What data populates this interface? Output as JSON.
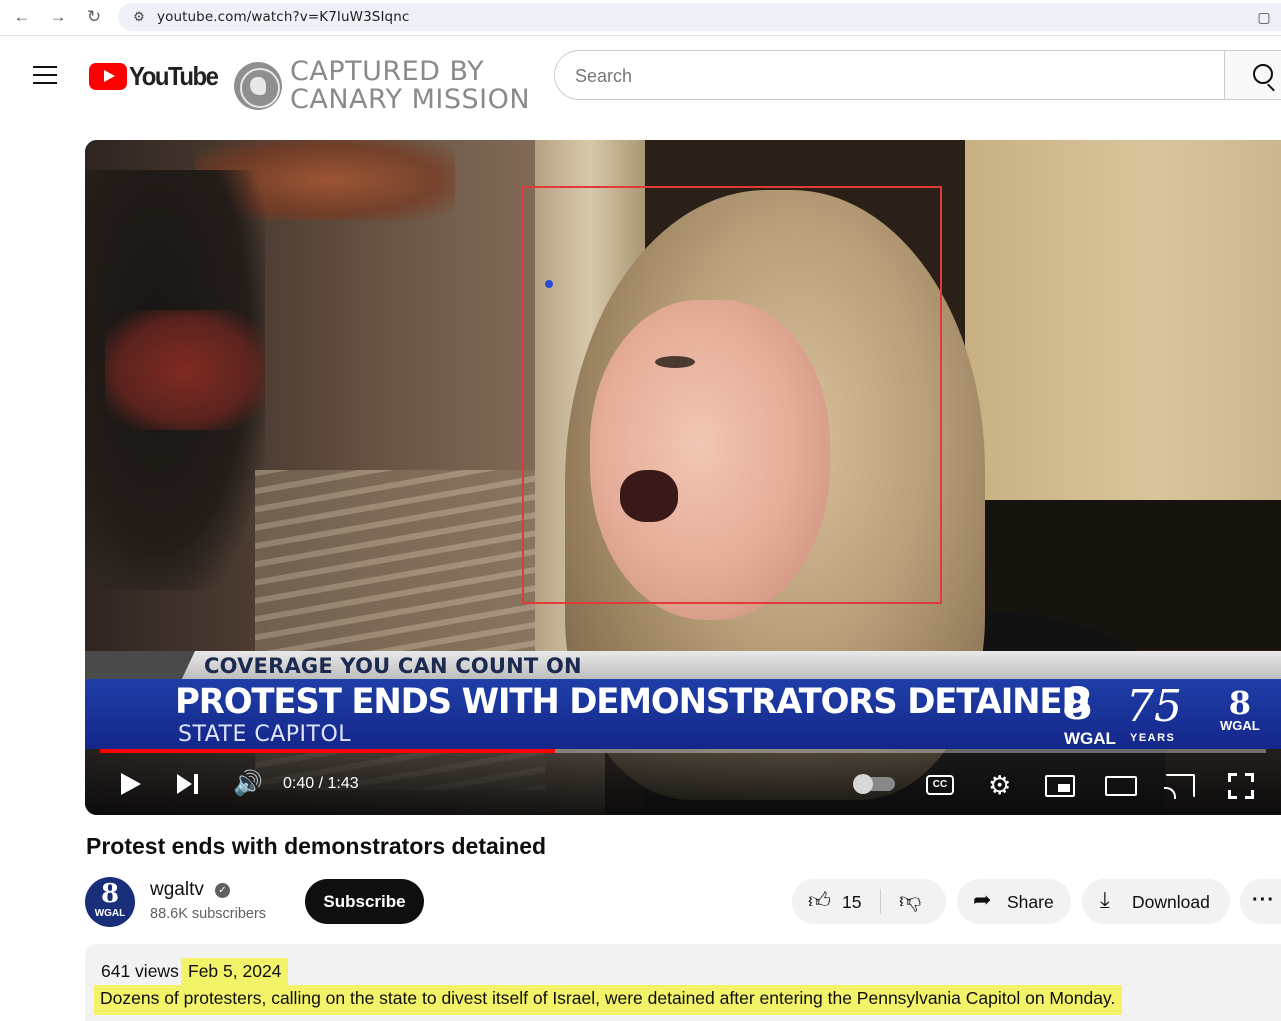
{
  "browser": {
    "url": "youtube.com/watch?v=K7IuW3SIqnc"
  },
  "header": {
    "logo_text": "YouTube",
    "overlay_watermark": "CAPTURED BY CANARY MISSION",
    "search_placeholder": "Search"
  },
  "video": {
    "lower_third": {
      "kicker": "COVERAGE YOU CAN COUNT ON",
      "headline": "PROTEST ENDS WITH DEMONSTRATORS DETAINED",
      "subline": "STATE CAPITOL",
      "station_number": "8",
      "station_call": "WGAL",
      "anniversary": "75",
      "anniversary_label": "YEARS"
    },
    "progress_fraction": 0.39,
    "time": "0:40 / 1:43",
    "accent_color": "#ff0000"
  },
  "title": "Protest ends with demonstrators detained",
  "channel": {
    "avatar_number": "8",
    "avatar_label": "WGAL",
    "name": "wgaltv",
    "subscribers": "88.6K subscribers",
    "subscribe_label": "Subscribe"
  },
  "actions": {
    "like_count": "15",
    "share_label": "Share",
    "download_label": "Download"
  },
  "description": {
    "views": "641 views",
    "date": "Feb 5, 2024",
    "text": "Dozens of protesters, calling on the state to divest itself of Israel, were detained after entering the Pennsylvania Capitol on Monday.",
    "highlight_color": "#f3f36a"
  }
}
